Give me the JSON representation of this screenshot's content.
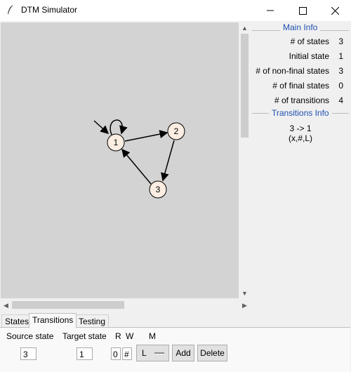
{
  "window": {
    "title": "DTM Simulator"
  },
  "main_info": {
    "title": "Main Info",
    "rows": [
      {
        "label": "# of states",
        "value": "3"
      },
      {
        "label": "Initial state",
        "value": "1"
      },
      {
        "label": "# of non-final states",
        "value": "3"
      },
      {
        "label": "# of final states",
        "value": "0"
      },
      {
        "label": "# of transitions",
        "value": "4"
      }
    ]
  },
  "transitions_info": {
    "title": "Transitions Info",
    "line1": "3 -> 1",
    "line2": "(x,#,L)"
  },
  "graph": {
    "nodes": [
      {
        "label": "1"
      },
      {
        "label": "2"
      },
      {
        "label": "3"
      }
    ],
    "node_fill": "#fceee2"
  },
  "tabs": [
    {
      "label": "States"
    },
    {
      "label": "Transitions"
    },
    {
      "label": "Testing"
    }
  ],
  "form": {
    "source_label": "Source state",
    "target_label": "Target state",
    "r_label": "R",
    "w_label": "W",
    "m_label": "M",
    "source_value": "3",
    "target_value": "1",
    "r_value": "0",
    "w_value": "#",
    "m_value": "L",
    "add_label": "Add",
    "delete_label": "Delete"
  }
}
